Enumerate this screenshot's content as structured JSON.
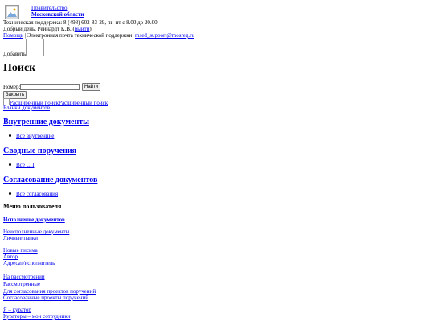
{
  "header": {
    "gov_line1": "Правительство",
    "gov_line2": "Московской области",
    "support_phone": "Техническая поддержка: 8 (498) 602-83-29, пн-пт с 8.00 до 20.00",
    "greeting": "Добрый день, Рейнардт К.В.",
    "logout_link": "выйти",
    "help_link": "Помощь",
    "email_label": "| Электронная почта технической поддержки:",
    "email_link": "msed_support@mosreg.ru",
    "add_label": "Добавить"
  },
  "search": {
    "title": "Поиск",
    "number_label": "Номер:",
    "number_value": "",
    "find_button": "Найти",
    "close_button": "Закрыть",
    "advanced_search_alt": "Расширенный поиск",
    "advanced_search_link": "Расширенный поиск",
    "blanks_link": "Бланки документов"
  },
  "sections": [
    {
      "title": "Внутренние документы",
      "item": "Все внутренние"
    },
    {
      "title": "Сводные поручения",
      "item": "Все СП"
    },
    {
      "title": "Согласование документов",
      "item": "Все согласования"
    }
  ],
  "user_menu": {
    "title": "Меню пользователя",
    "execution_link": "Исполнение документов",
    "links": [
      "Неисполненные документы",
      "Личные папки",
      "Новые письма",
      "Автор",
      "Адресат/исполнитель",
      "На рассмотрении",
      "Рассмотренные",
      "Для согласования проектов поручений",
      "Согласованные проекты поручений",
      "Я – куратор",
      "Кураторы – мои сотрудники"
    ]
  }
}
